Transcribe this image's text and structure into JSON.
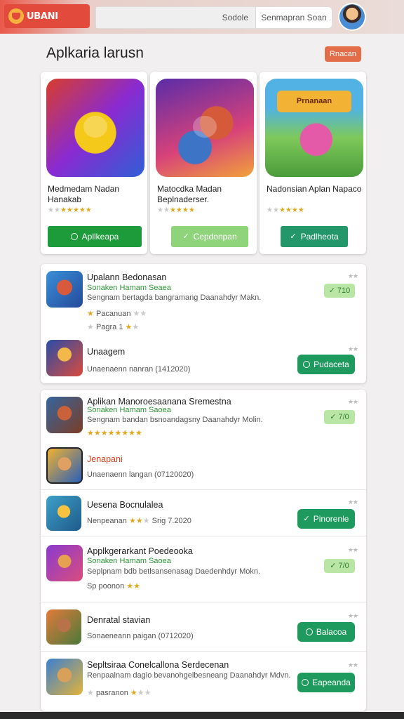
{
  "header": {
    "logo_text": "UBANI",
    "search_tab_1": "Sodole",
    "search_tab_2": "Senmapran Soan"
  },
  "section": {
    "title": "Aplkaria larusn",
    "button": "Rnacan"
  },
  "featured": [
    {
      "title": "Medmedam Nadan Hanakab",
      "rating": 5,
      "button": "Apllkeapa",
      "button_color": "#1d9a3a"
    },
    {
      "title": "Matocdka Madan Beplnaderser.",
      "rating": 5,
      "button": "Cepdonpan",
      "button_color": "#8fd37a"
    },
    {
      "title": "Nadonsian Aplan Napaco",
      "rating": 5,
      "button": "Padlheota",
      "button_color": "#23966a"
    }
  ],
  "featured_art_banner": "Prnanaan",
  "list_panel_1": [
    {
      "name": "Upalann Bedonasan",
      "sub": "Sonaken Hamam Seaea",
      "desc": "Sengnam bertagda bangramang Daanahdyr Makn.",
      "meta1": "Pacanuan",
      "meta2": "Pagra 1",
      "pill": "710"
    },
    {
      "name": "Unaagem",
      "desc": "Unaenaenn nanran (1412020)",
      "button": "Pudaceta"
    }
  ],
  "list_panel_2": [
    {
      "name": "Aplikan Manoroesaanana Sremestna",
      "sub": "Sonaken Hamam Saoea",
      "desc": "Sengnam bandan bsnoandagsny Daanahdyr Molin.",
      "pill": "7/0"
    },
    {
      "name": "Jenapani",
      "desc": "Unaenaenn langan (07120020)"
    },
    {
      "name": "Uesena Bocnulalea",
      "desc": "Nenpeanan",
      "desc2": "Srig 7.2020",
      "button": "Pinorenle"
    },
    {
      "name": "Applkgerarkant Poedeooka",
      "sub": "Sonaken Hamam Saoea",
      "desc": "Seplpnam bdb betlsansenasag Daedenhdyr Mokn.",
      "meta1": "Sp poonon",
      "pill": "7/0"
    },
    {
      "name": "Denratal stavian",
      "desc": "Sonaeneann paigan (0712020)",
      "button": "Balacoa"
    },
    {
      "name": "Sepltsiraa Conelcallona Serdecenan",
      "desc": "Renpaalnam dagio bevanohgelbesneang Daanahdyr Mdvn.",
      "meta1": "pasranon",
      "button": "Eapeanda"
    }
  ]
}
